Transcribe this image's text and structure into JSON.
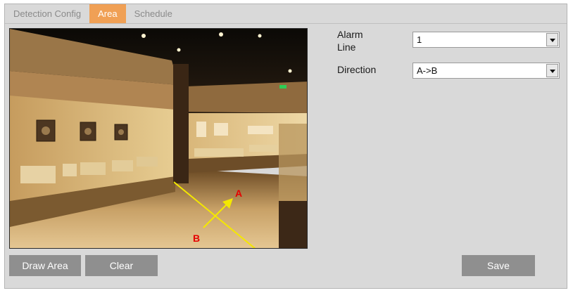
{
  "tabs": [
    {
      "label": "Detection Config",
      "active": false
    },
    {
      "label": "Area",
      "active": true
    },
    {
      "label": "Schedule",
      "active": false
    }
  ],
  "video": {
    "label_a": "A",
    "label_b": "B"
  },
  "form": {
    "alarm_line": {
      "label": "Alarm Line",
      "value": "1"
    },
    "direction": {
      "label": "Direction",
      "value": "A->B"
    }
  },
  "buttons": {
    "draw_area": "Draw Area",
    "clear": "Clear",
    "save": "Save"
  },
  "colors": {
    "active_tab": "#f0a055",
    "button": "#8f8f8f",
    "line": "#f4e800",
    "marker": "#e60000"
  }
}
